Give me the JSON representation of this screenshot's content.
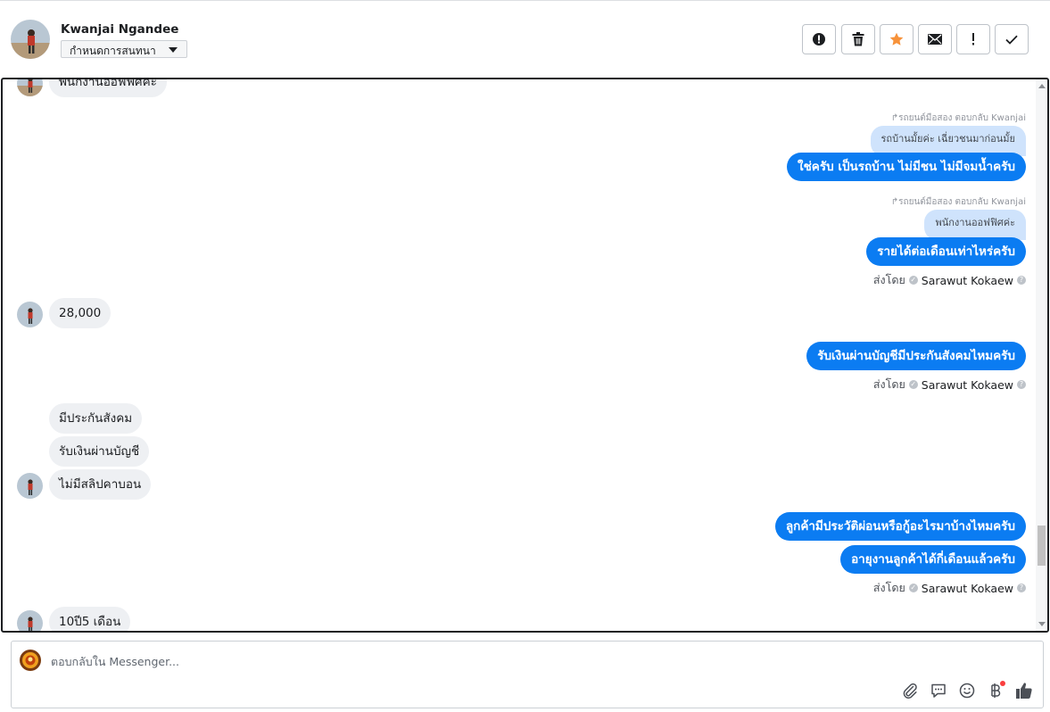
{
  "header": {
    "contact_name": "Kwanjai Ngandee",
    "assign_label": "กำหนดการสนทนา"
  },
  "messages": {
    "top_partial": "พนักงานออฟฟิศค่ะ",
    "reply1_note": "↱รถยนต์มือสอง ตอบกลับ Kwanjai",
    "reply1_quote": "รถบ้านมั้ยค่ะ เฉี่ยวชนมาก่อนมั้ย",
    "reply1_text": "ใช่ครับ เป็นรถบ้าน ไม่มีชน ไม่มีจมน้ำครับ",
    "reply2_note": "↱รถยนต์มือสอง ตอบกลับ Kwanjai",
    "reply2_quote": "พนักงานออฟฟิศค่ะ",
    "reply2_text": "รายได้ต่อเดือนเท่าไหร่ครับ",
    "sent_by_label": "ส่งโดย",
    "agent_name": "Sarawut Kokaew",
    "in_salary": "28,000",
    "out_account": "รับเงินผ่านบัญชีมีประกันสังคมไหมครับ",
    "in_ss": "มีประกันสังคม",
    "in_account": "รับเงินผ่านบัญชี",
    "in_slip": "ไม่มีสลิปคาบอน",
    "out_history": "ลูกค้ามีประวัติผ่อนหรือกู้อะไรมาบ้างไหมครับ",
    "out_tenure": "อายุงานลูกค้าได้กี่เดือนแล้วครับ",
    "in_tenure": "10ปี5 เดือน"
  },
  "composer": {
    "placeholder": "ตอบกลับใน Messenger..."
  },
  "colors": {
    "outgoing": "#0b7cf2",
    "incoming": "#eef0f3",
    "quote": "#cfe3fc",
    "star": "#f7923a"
  }
}
